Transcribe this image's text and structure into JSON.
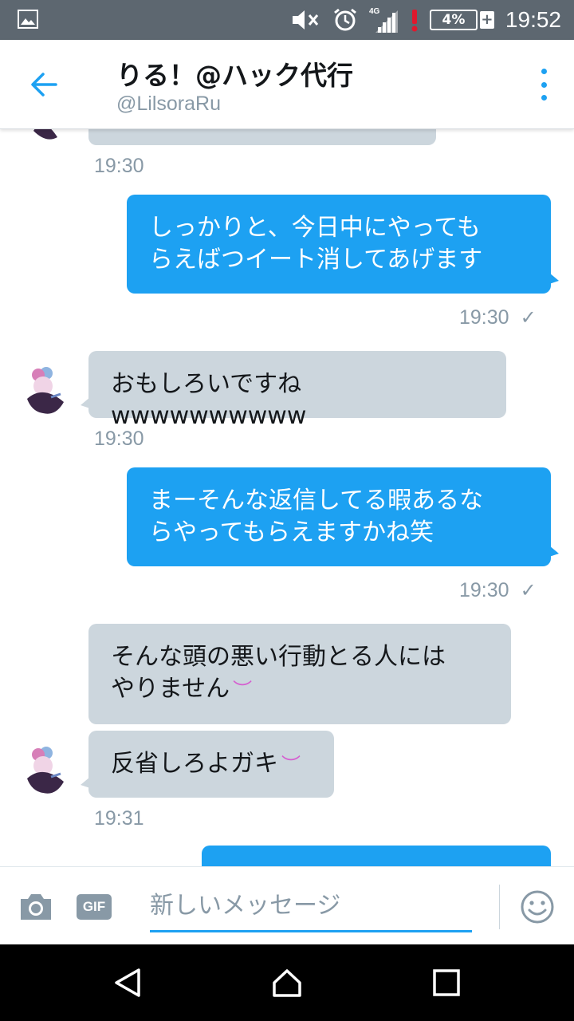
{
  "status_bar": {
    "network": "4G",
    "battery_percent": "4%",
    "battery_plus": "+",
    "time": "19:52",
    "icons": [
      "image-icon",
      "mute-icon",
      "alarm-icon",
      "signal-icon",
      "alert-icon",
      "battery-icon"
    ]
  },
  "header": {
    "title": "りる！@ハック代行",
    "handle": "@LilsoraRu",
    "back_icon": "back-arrow-icon",
    "menu_icon": "more-vertical-icon"
  },
  "messages": [
    {
      "direction": "incoming",
      "text": "",
      "time": "19:30"
    },
    {
      "direction": "outgoing",
      "line1": "しっかりと、今日中にやっても",
      "line2": "らえばつイート消してあげます",
      "time": "19:30",
      "status": "✓"
    },
    {
      "direction": "incoming",
      "text": "おもしろいですねwwwwwwwwww",
      "time": "19:30"
    },
    {
      "direction": "outgoing",
      "line1": "まーそんな返信してる暇あるな",
      "line2": "らやってもらえますかね笑",
      "time": "19:30",
      "status": "✓"
    },
    {
      "direction": "incoming",
      "line1": "そんな頭の悪い行動とる人には",
      "line2": "やりません",
      "emoji": "︶",
      "time": ""
    },
    {
      "direction": "incoming",
      "text": "反省しろよガキ",
      "emoji": "︶",
      "time": "19:31"
    },
    {
      "direction": "outgoing",
      "text": ""
    }
  ],
  "composer": {
    "camera_icon": "camera-icon",
    "gif_label": "GIF",
    "placeholder": "新しいメッセージ",
    "emoji_icon": "smiley-icon"
  },
  "nav": {
    "icons": [
      "back-triangle-icon",
      "home-icon",
      "recents-icon"
    ]
  },
  "colors": {
    "accent": "#1da1f2",
    "incoming_bubble": "#ccd6dd",
    "status_bar": "#5d6770",
    "secondary_text": "#8899a6"
  }
}
